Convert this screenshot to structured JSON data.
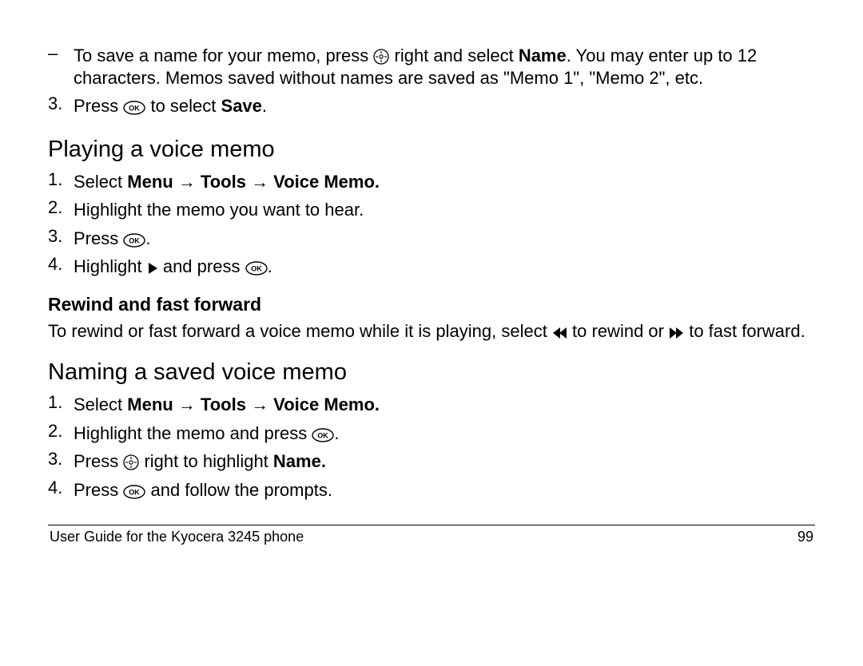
{
  "intro": {
    "dash": "–",
    "line1a": "To save a name for your memo, press ",
    "line1b": " right and select ",
    "name": "Name",
    "line1c": ". You may enter up to 12 characters. Memos saved without names are saved as \"Memo 1\", \"Memo 2\", etc."
  },
  "step3": {
    "num": "3.",
    "a": "Press ",
    "b": " to select ",
    "save": "Save",
    "c": "."
  },
  "playing": {
    "heading": "Playing a voice memo",
    "s1": {
      "num": "1.",
      "a": "Select ",
      "path": "Menu → Tools → Voice Memo."
    },
    "s2": {
      "num": "2.",
      "text": "Highlight the memo you want to hear."
    },
    "s3": {
      "num": "3.",
      "a": "Press ",
      "b": "."
    },
    "s4": {
      "num": "4.",
      "a": "Highlight ",
      "b": " and press ",
      "c": "."
    }
  },
  "rewind": {
    "heading": "Rewind and fast forward",
    "a": "To rewind or fast forward a voice memo while it is playing, select ",
    "b": " to rewind or ",
    "c": " to fast forward."
  },
  "naming": {
    "heading": "Naming a saved voice memo",
    "s1": {
      "num": "1.",
      "a": "Select ",
      "path": "Menu → Tools → Voice Memo."
    },
    "s2": {
      "num": "2.",
      "a": "Highlight the memo and press ",
      "b": "."
    },
    "s3": {
      "num": "3.",
      "a": "Press ",
      "b": " right to highlight ",
      "name": "Name."
    },
    "s4": {
      "num": "4.",
      "a": "Press ",
      "b": " and follow the prompts."
    }
  },
  "footer": {
    "left": "User Guide for the Kyocera 3245 phone",
    "right": "99"
  }
}
